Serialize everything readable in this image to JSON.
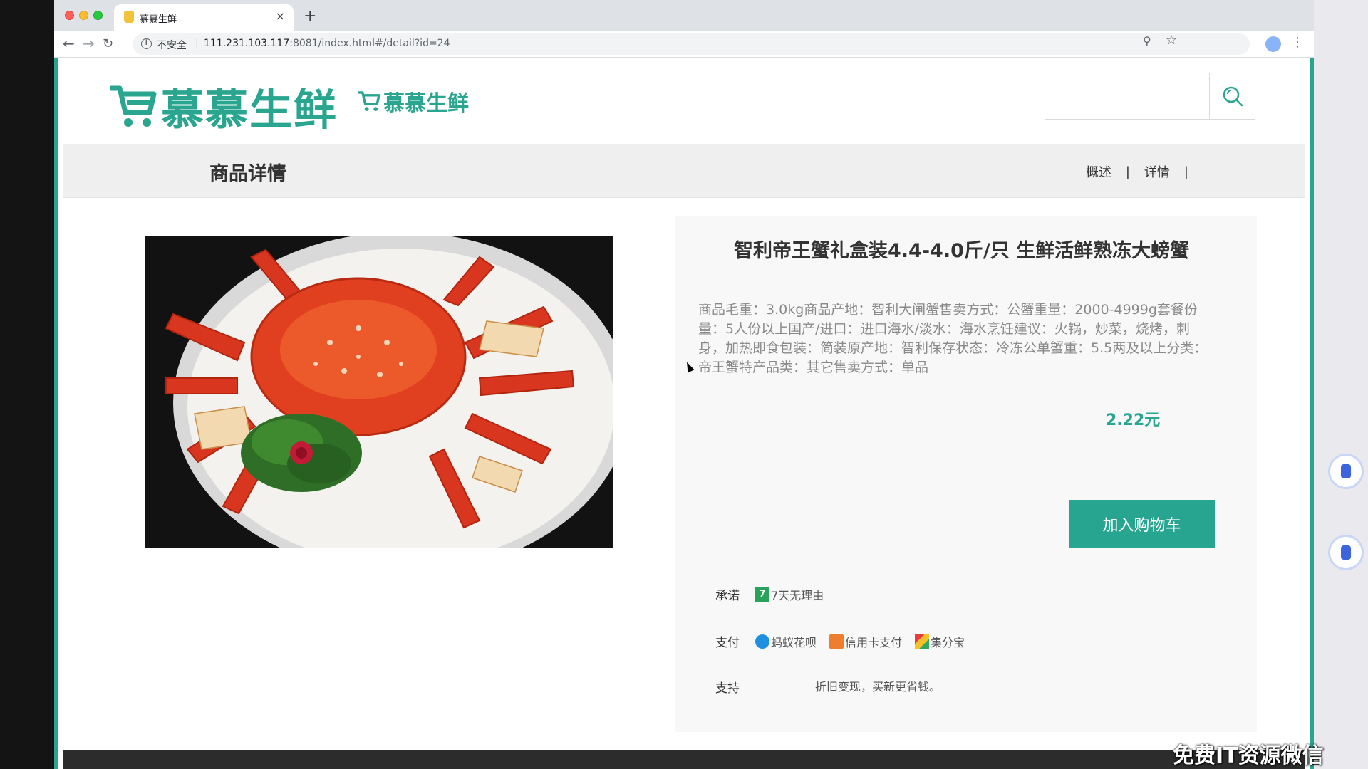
{
  "browser": {
    "tab_title": "慕慕生鲜",
    "tab_close": "×",
    "new_tab": "+",
    "security_label": "不安全",
    "url_host": "111.231.103.117",
    "url_path": ":8081/index.html#/detail?id=24"
  },
  "header": {
    "logo_big_text": "慕慕生鲜",
    "logo_small_text": "慕慕生鲜",
    "search_placeholder": "",
    "brand_color": "#2aa58f"
  },
  "section": {
    "title": "商品详情",
    "nav": [
      {
        "label": "概述"
      },
      {
        "label": "详情"
      }
    ],
    "separator": "|"
  },
  "product": {
    "image_alt": "智利帝王蟹",
    "title": "智利帝王蟹礼盒装4.4-4.0斤/只 生鲜活鲜熟冻大螃蟹",
    "description": "商品毛重：3.0kg商品产地：智利大闸蟹售卖方式：公蟹重量：2000-4999g套餐份量：5人份以上国产/进口：进口海水/淡水：海水烹饪建议：火锅，炒菜，烧烤，刺身，加热即食包装：简装原产地：智利保存状态：冷冻公单蟹重：5.5两及以上分类：帝王蟹特产品类：其它售卖方式：单品",
    "price": "2.22元",
    "add_to_cart": "加入购物车"
  },
  "meta": {
    "promise_label": "承诺",
    "promise_items": [
      {
        "icon": "seven-day-icon",
        "icon_text": "7",
        "label": "7天无理由"
      }
    ],
    "pay_label": "支付",
    "pay_items": [
      {
        "icon": "ant-huabei-icon",
        "label": "蚂蚁花呗"
      },
      {
        "icon": "credit-card-icon",
        "label": "信用卡支付"
      },
      {
        "icon": "jifenbao-icon",
        "label": "集分宝"
      }
    ],
    "support_label": "支持",
    "support_text": "折旧变现，买新更省钱。"
  },
  "overlay": {
    "watermark": "免费IT资源微信"
  }
}
